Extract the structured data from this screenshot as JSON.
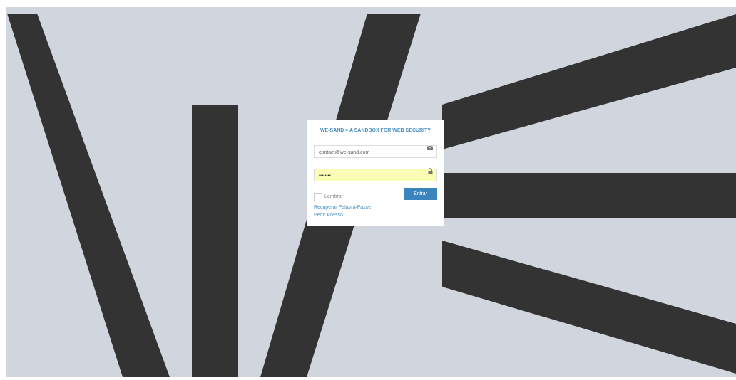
{
  "login": {
    "title": "WE-SAND » A SANDBOX FOR WEB SECURITY",
    "email": {
      "value": "contact@we-sand.com"
    },
    "password": {
      "value": "••••••••",
      "autofilled": true
    },
    "remember": {
      "label": "Lembrar",
      "checked": false
    },
    "submit": "Entrar",
    "links": [
      "Recuperar Palavra-Passe",
      "Pedir Acesso"
    ]
  }
}
